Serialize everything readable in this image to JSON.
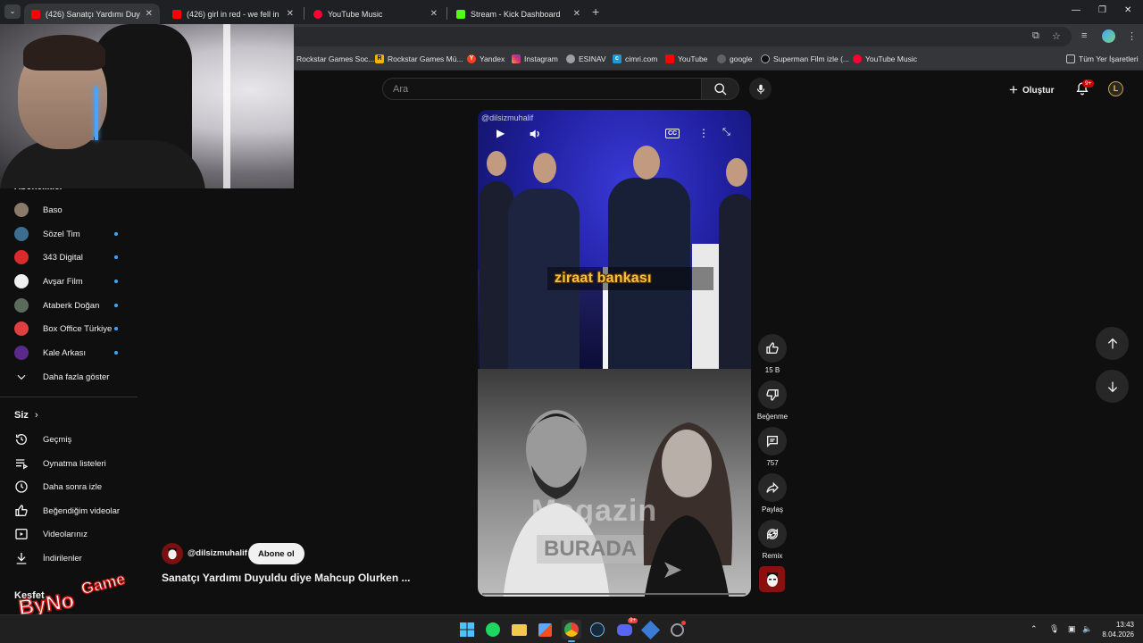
{
  "browser": {
    "tabs": [
      {
        "title": "(426) Sanatçı Yardımı Duyuldu d",
        "active": true
      },
      {
        "title": "(426) girl in red - we fell in love",
        "active": false
      },
      {
        "title": "YouTube Music",
        "active": false
      },
      {
        "title": "Stream - Kick Dashboard",
        "active": false
      }
    ],
    "bookmarks": [
      "Rockstar Games Soc...",
      "Rockstar Games Mü...",
      "Yandex",
      "Instagram",
      "ESINAV",
      "cimri.com",
      "YouTube",
      "google",
      "Superman Film izle (...",
      "YouTube Music"
    ],
    "all_bookmarks": "Tüm Yer İşaretleri"
  },
  "youtube": {
    "search_placeholder": "Ara",
    "create_label": "Oluştur",
    "notif_badge": "9+",
    "avatar_letter": "L"
  },
  "sidebar": {
    "subscriptions_heading": "Abonelikler",
    "subscriptions": [
      {
        "label": "Baso",
        "color": "#8a7a6a",
        "dot": false
      },
      {
        "label": "Sözel Tim",
        "color": "#3c6e8f",
        "dot": true
      },
      {
        "label": "343 Digital",
        "color": "#d92b2b",
        "dot": true
      },
      {
        "label": "Avşar Film",
        "color": "#f0f0f0",
        "dot": true
      },
      {
        "label": "Ataberk Doğan",
        "color": "#5b6b5b",
        "dot": true
      },
      {
        "label": "Box Office Türkiye",
        "color": "#e04040",
        "dot": true
      },
      {
        "label": "Kale Arkası",
        "color": "#5a2a8a",
        "dot": true
      }
    ],
    "show_more": "Daha fazla göster",
    "you_heading": "Siz",
    "you_items": [
      "Geçmiş",
      "Oynatma listeleri",
      "Daha sonra izle",
      "Beğendiğim videolar",
      "Videolarınız",
      "İndirilenler"
    ],
    "explore_heading": "Keşfet"
  },
  "video": {
    "watermark": "@dilsizmuhalif",
    "caption": "ziraat bankası",
    "cc_label": "CC",
    "overlay_text_1": "Magazin",
    "overlay_text_2": "BURADA",
    "channel": "@dilsizmuhalif",
    "subscribe_label": "Abone ol",
    "title": "Sanatçı Yardımı Duyuldu diye Mahcup Olurken ..."
  },
  "actions": {
    "like_count": "15 B",
    "dislike_label": "Beğenme",
    "comment_count": "757",
    "share_label": "Paylaş",
    "remix_label": "Remix"
  },
  "game_overlay": {
    "text_1": "ByNo",
    "text_2": "Game"
  },
  "taskbar": {
    "time": "13:43",
    "date": "8.04.2026",
    "discord_badge": "9+"
  }
}
